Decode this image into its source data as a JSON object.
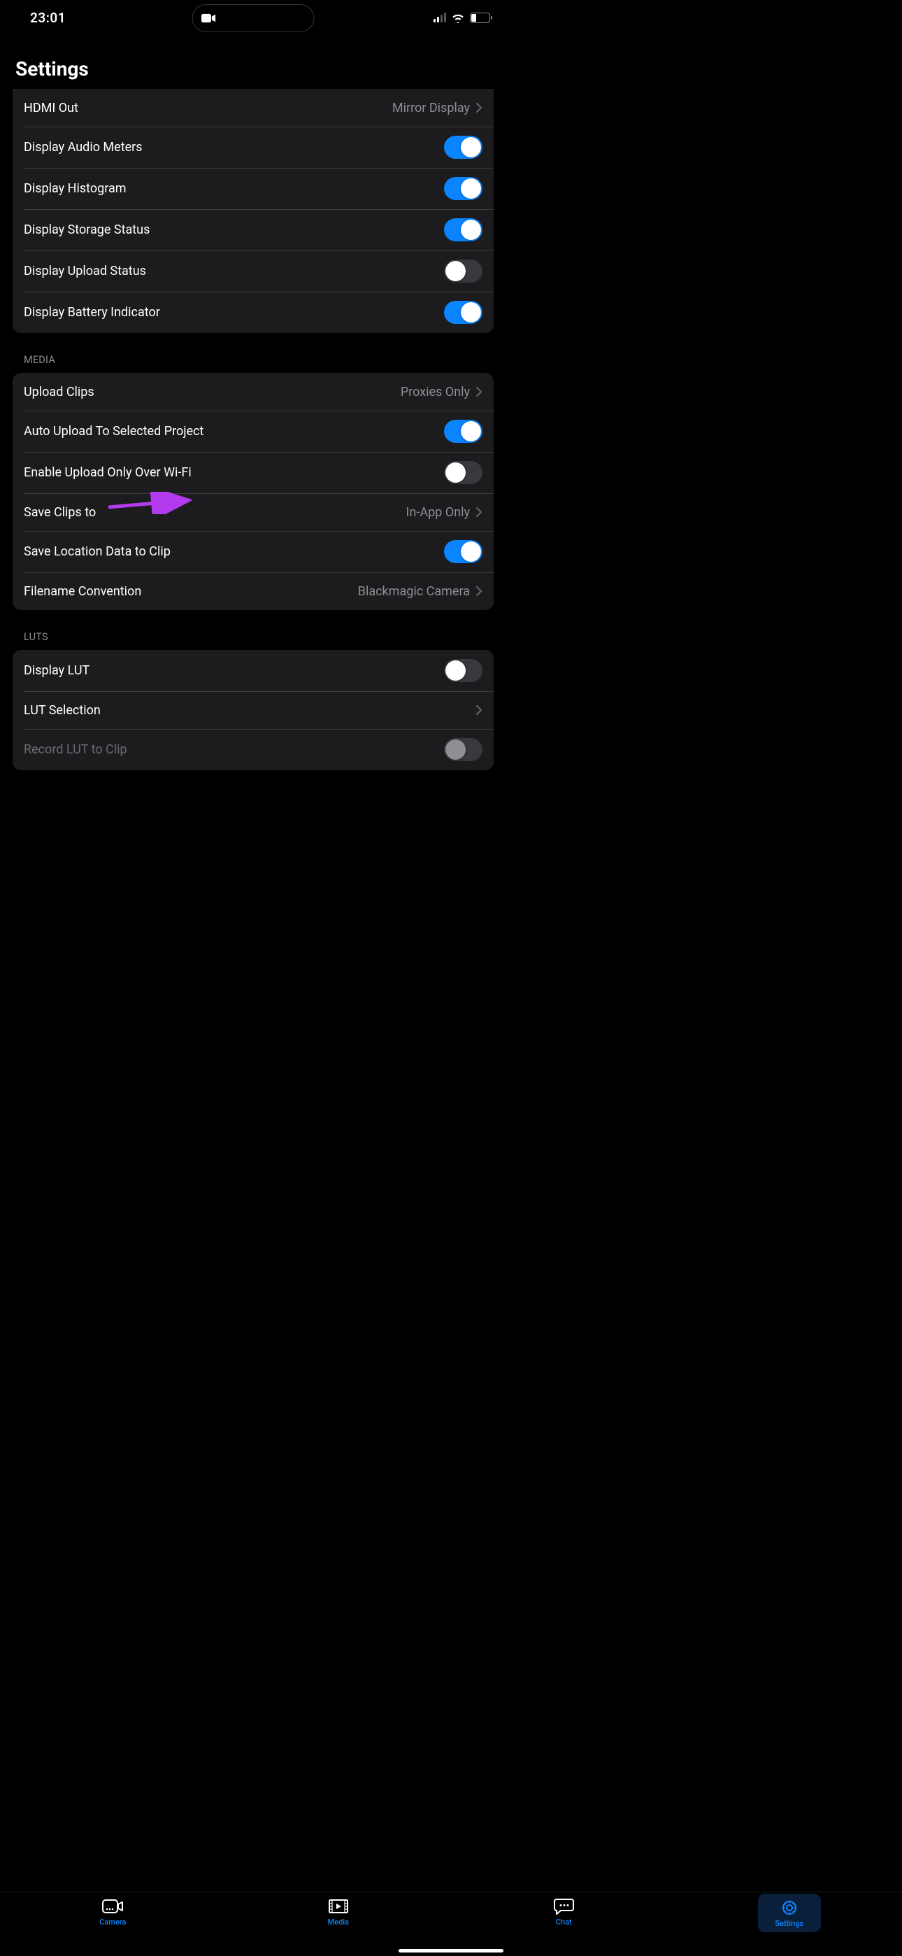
{
  "status": {
    "time": "23:01",
    "battery": "26"
  },
  "page": {
    "title": "Settings"
  },
  "display_section": {
    "hdmi_out": {
      "label": "HDMI Out",
      "value": "Mirror Display"
    },
    "audio_meters": {
      "label": "Display Audio Meters",
      "on": true
    },
    "histogram": {
      "label": "Display Histogram",
      "on": true
    },
    "storage_status": {
      "label": "Display Storage Status",
      "on": true
    },
    "upload_status": {
      "label": "Display Upload Status",
      "on": false
    },
    "battery_indicator": {
      "label": "Display Battery Indicator",
      "on": true
    }
  },
  "media_section": {
    "header": "MEDIA",
    "upload_clips": {
      "label": "Upload Clips",
      "value": "Proxies Only"
    },
    "auto_upload": {
      "label": "Auto Upload To Selected Project",
      "on": true
    },
    "wifi_only": {
      "label": "Enable Upload Only Over Wi-Fi",
      "on": false
    },
    "save_clips_to": {
      "label": "Save Clips to",
      "value": "In-App Only"
    },
    "save_location": {
      "label": "Save Location Data to Clip",
      "on": true
    },
    "filename_convention": {
      "label": "Filename Convention",
      "value": "Blackmagic Camera"
    }
  },
  "luts_section": {
    "header": "LUTS",
    "display_lut": {
      "label": "Display LUT",
      "on": false
    },
    "lut_selection": {
      "label": "LUT Selection"
    },
    "record_lut": {
      "label": "Record LUT to Clip",
      "on": false,
      "disabled": true
    }
  },
  "tabs": {
    "camera": "Camera",
    "media": "Media",
    "chat": "Chat",
    "settings": "Settings"
  },
  "annotation": {
    "color": "#b43af0"
  }
}
